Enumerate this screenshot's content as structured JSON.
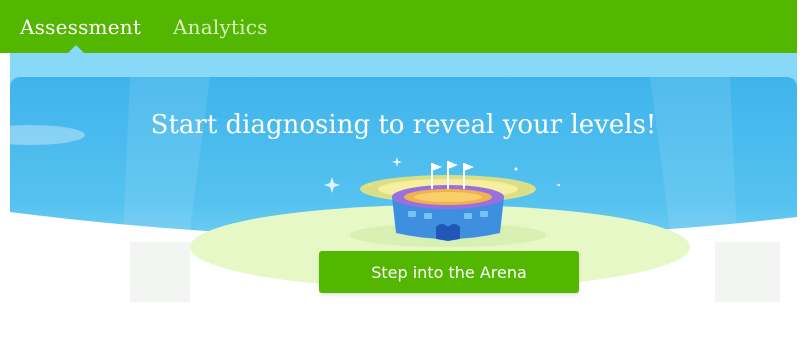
{
  "nav": {
    "tabs": [
      {
        "label": "Assessment",
        "active": true
      },
      {
        "label": "Analytics",
        "active": false
      }
    ]
  },
  "hero": {
    "headline": "Start diagnosing to reveal your levels!",
    "cta_label": "Step into the Arena",
    "illustration": "arena-stadium-icon"
  },
  "colors": {
    "nav_green": "#53b600",
    "sky_blue": "#3fb4ec",
    "band_blue": "#88d8f8",
    "button_green": "#53b600"
  }
}
